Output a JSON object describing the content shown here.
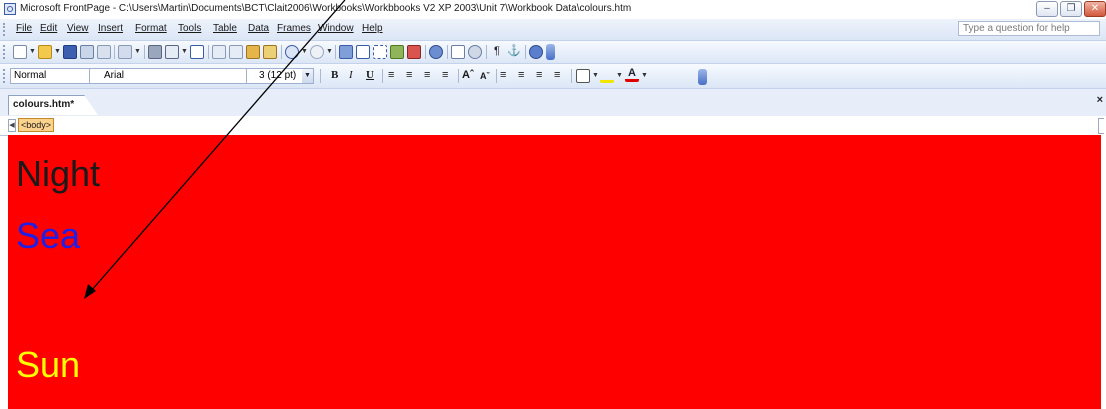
{
  "window": {
    "title": "Microsoft FrontPage - C:\\Users\\Martin\\Documents\\BCT\\Clait2006\\Workbooks\\Workbbooks V2 XP 2003\\Unit 7\\Workbook Data\\colours.htm"
  },
  "menu": {
    "items": [
      "File",
      "Edit",
      "View",
      "Insert",
      "Format",
      "Tools",
      "Table",
      "Data",
      "Frames",
      "Window",
      "Help"
    ],
    "help_placeholder": "Type a question for help"
  },
  "format_toolbar": {
    "style": "Normal",
    "font": "Arial",
    "size": "3 (12 pt)"
  },
  "tab": {
    "label": "colours.htm*"
  },
  "quick_tag": {
    "tag": "<body>"
  },
  "page": {
    "background_color": "#ff0000",
    "words": [
      {
        "text": "Night",
        "color": "#1a1a1a"
      },
      {
        "text": "Sea",
        "color": "#1f1fe6"
      },
      {
        "text": "Sun",
        "color": "#ffff00"
      }
    ]
  }
}
